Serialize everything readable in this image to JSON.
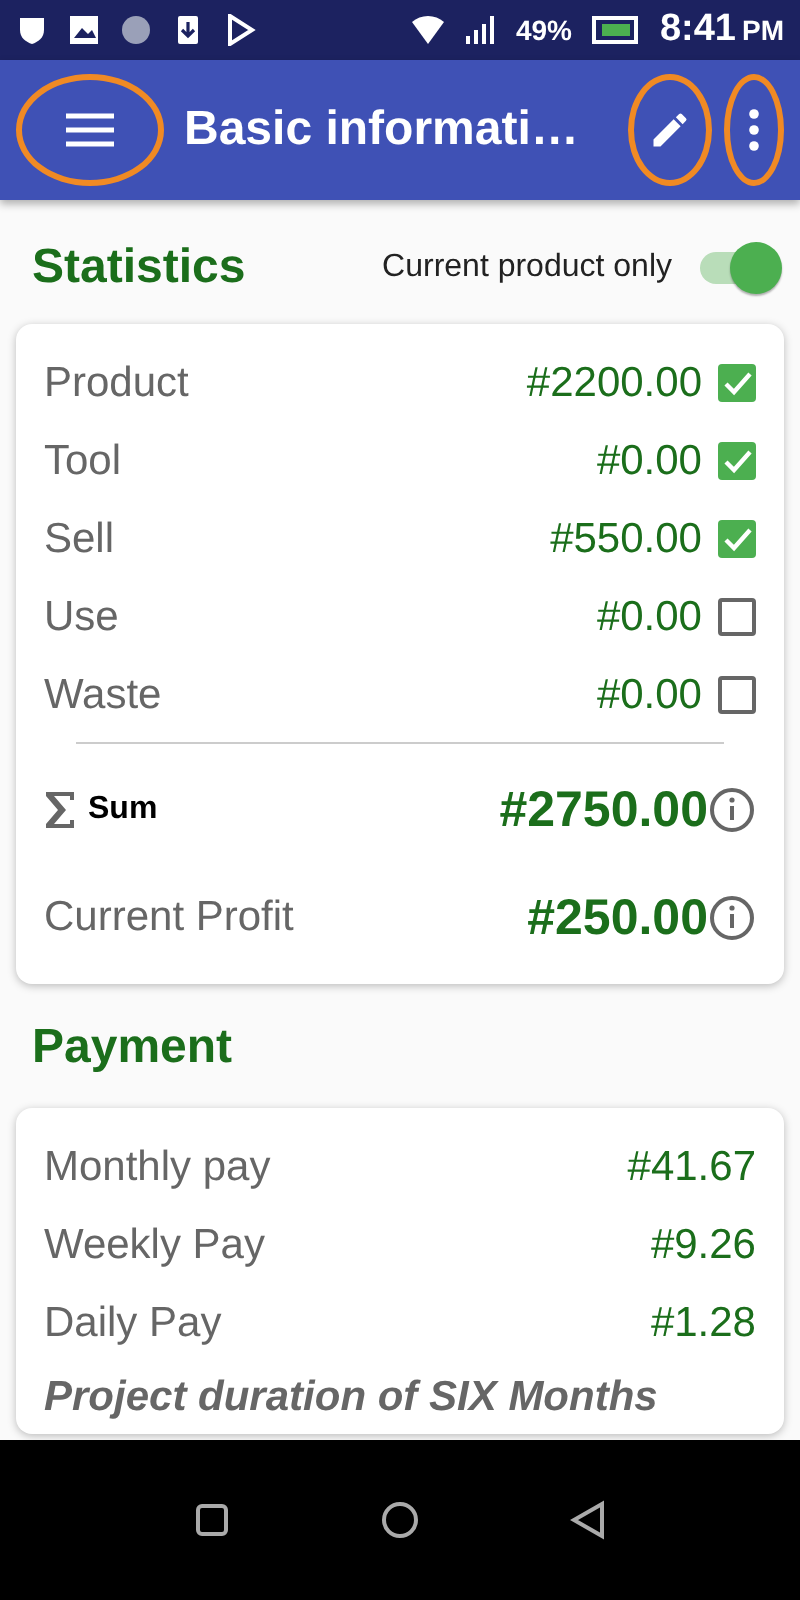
{
  "status_bar": {
    "battery": "49%",
    "time": "8:41",
    "ampm": "PM"
  },
  "app_bar": {
    "title": "Basic informati…",
    "menu_highlighted": true,
    "edit_highlighted": true,
    "more_highlighted": true
  },
  "statistics": {
    "title": "Statistics",
    "toggle_label": "Current product only",
    "toggle_on": true,
    "rows": [
      {
        "label": "Product",
        "value": "#2200.00",
        "checked": true
      },
      {
        "label": "Tool",
        "value": "#0.00",
        "checked": true
      },
      {
        "label": "Sell",
        "value": "#550.00",
        "checked": true
      },
      {
        "label": "Use",
        "value": "#0.00",
        "checked": false
      },
      {
        "label": "Waste",
        "value": "#0.00",
        "checked": false
      }
    ],
    "sum": {
      "label": "Sum",
      "value": "#2750.00"
    },
    "profit": {
      "label": "Current Profit",
      "value": "#250.00"
    }
  },
  "payment": {
    "title": "Payment",
    "rows": [
      {
        "label": "Monthly pay",
        "value": "#41.67"
      },
      {
        "label": "Weekly Pay",
        "value": "#9.26"
      },
      {
        "label": "Daily Pay",
        "value": "#1.28"
      }
    ],
    "note": "Project duration of  SIX  Months"
  }
}
